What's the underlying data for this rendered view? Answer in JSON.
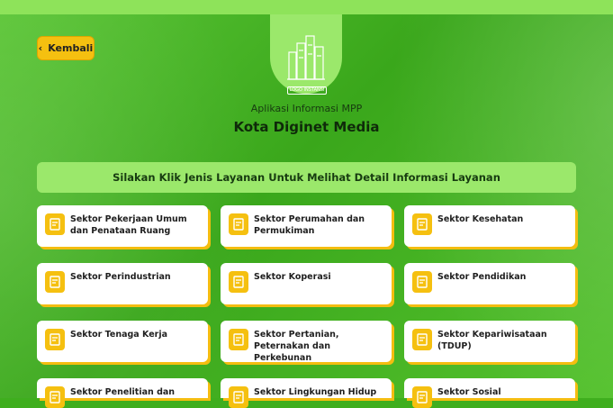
{
  "header": {
    "back_label": "Kembali",
    "logo_text": "LOGO INSTANSI",
    "subtitle": "Aplikasi Informasi MPP",
    "title": "Kota Diginet Media"
  },
  "banner": {
    "text": "Silakan Klik Jenis Layanan Untuk Melihat Detail Informasi Layanan"
  },
  "sectors": [
    {
      "label": "Sektor Pekerjaan Umum dan Penataan Ruang"
    },
    {
      "label": "Sektor Perumahan dan Permukiman"
    },
    {
      "label": "Sektor Kesehatan"
    },
    {
      "label": "Sektor Perindustrian"
    },
    {
      "label": "Sektor Koperasi"
    },
    {
      "label": "Sektor Pendidikan"
    },
    {
      "label": "Sektor Tenaga Kerja"
    },
    {
      "label": "Sektor Pertanian, Peternakan dan Perkebunan"
    },
    {
      "label": "Sektor Kepariwisataan (TDUP)"
    },
    {
      "label": "Sektor Penelitian dan"
    },
    {
      "label": "Sektor Lingkungan Hidup"
    },
    {
      "label": "Sektor Sosial"
    }
  ],
  "icons": {
    "back": "chevron-left-icon",
    "sector": "document-icon",
    "logo": "city-buildings-icon"
  },
  "colors": {
    "accent": "#f5c010",
    "background": "#3fae1e",
    "banner": "#9be86b"
  }
}
